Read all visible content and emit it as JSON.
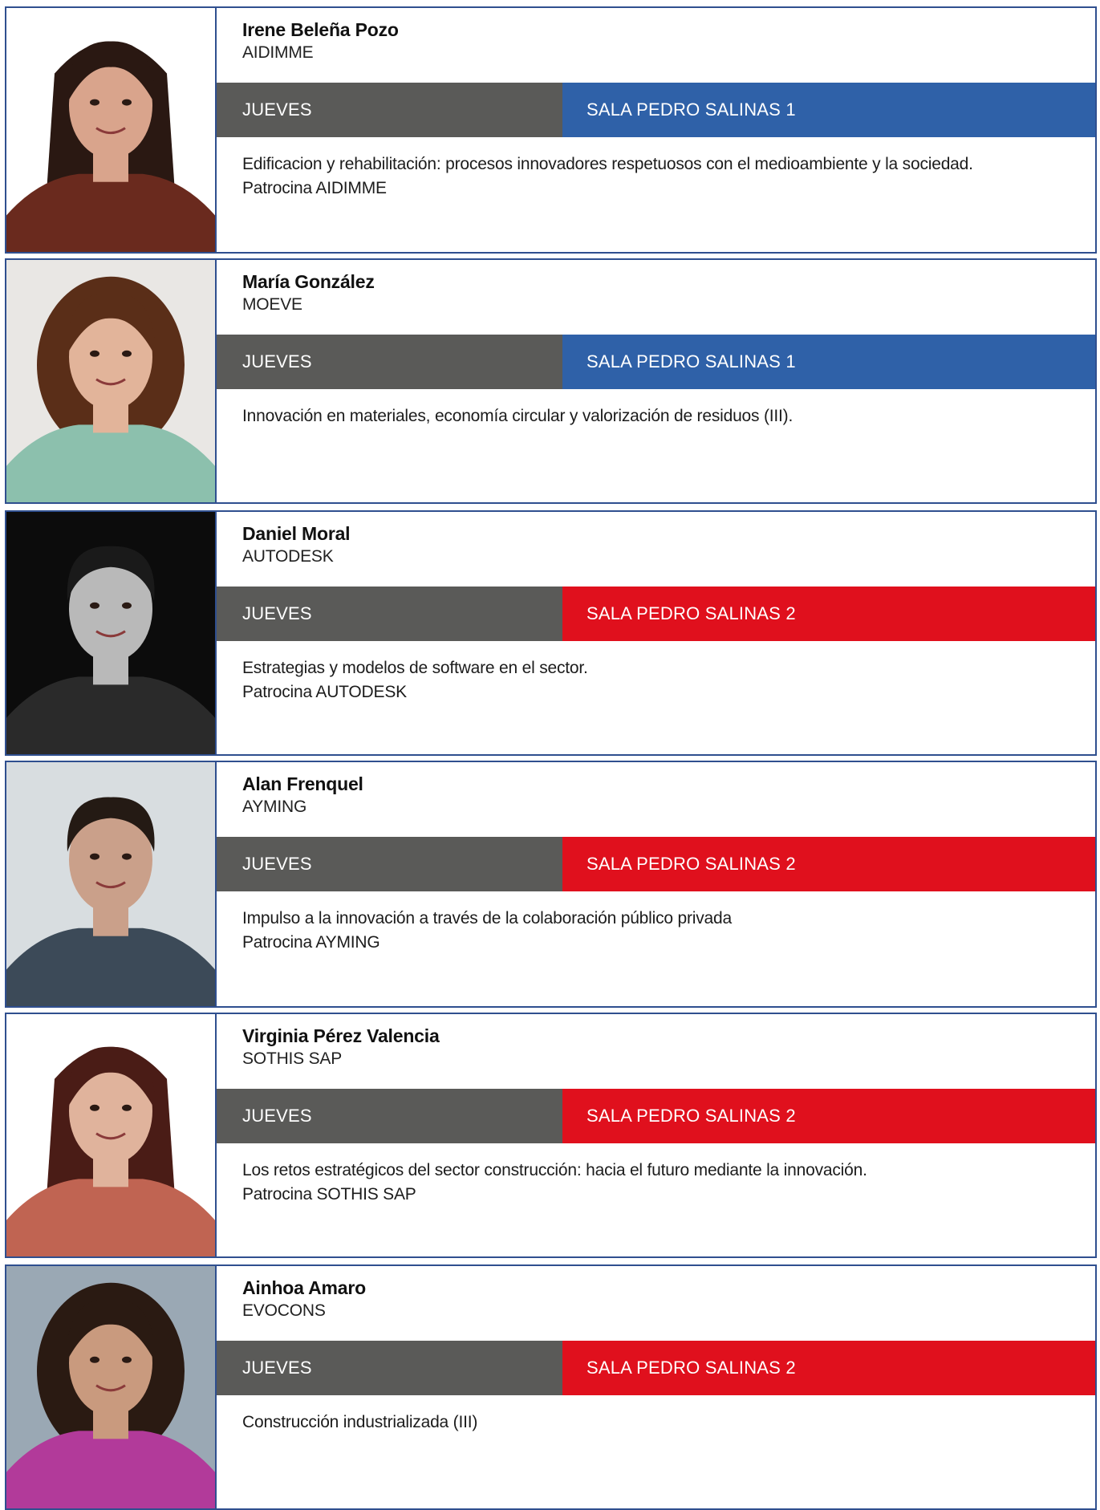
{
  "speakers": [
    {
      "name": "Irene Beleña Pozo",
      "company": "AIDIMME",
      "day": "JUEVES",
      "room": "SALA PEDRO SALINAS 1",
      "room_color": "#2f61a8",
      "description": "Edificacion y rehabilitación: procesos innovadores respetuosos con el medioambiente y la sociedad.",
      "sponsor": "Patrocina AIDIMME",
      "photo": {
        "background": "#ffffff",
        "hair": "#2a1812",
        "skin": "#d9a48c",
        "clothing": "#6a2a1e",
        "hair_style": "long"
      }
    },
    {
      "name": "María González",
      "company": "MOEVE",
      "day": "JUEVES",
      "room": "SALA PEDRO SALINAS 1",
      "room_color": "#2f61a8",
      "description": "Innovación en materiales, economía circular y valorización de residuos (III).",
      "sponsor": "",
      "photo": {
        "background": "#e9e7e4",
        "hair": "#5a2e18",
        "skin": "#e2b49a",
        "clothing": "#8cc0ad",
        "hair_style": "curly"
      }
    },
    {
      "name": "Daniel Moral",
      "company": "AUTODESK",
      "day": "JUEVES",
      "room": "SALA PEDRO SALINAS 2",
      "room_color": "#e0101d",
      "description": "Estrategias y modelos de software en el sector.",
      "sponsor": "Patrocina AUTODESK",
      "photo": {
        "background": "#0c0c0c",
        "hair": "#1a1a1a",
        "skin": "#b9b9b9",
        "clothing": "#2a2a2a",
        "hair_style": "short"
      }
    },
    {
      "name": "Alan Frenquel",
      "company": "AYMING",
      "day": "JUEVES",
      "room": "SALA PEDRO SALINAS 2",
      "room_color": "#e0101d",
      "description": "Impulso a la innovación a través de la colaboración público privada",
      "sponsor": "Patrocina AYMING",
      "photo": {
        "background": "#d8dde0",
        "hair": "#241a14",
        "skin": "#caa08a",
        "clothing": "#3c4a58",
        "hair_style": "short"
      }
    },
    {
      "name": "Virginia Pérez Valencia",
      "company": "SOTHIS SAP",
      "day": "JUEVES",
      "room": "SALA PEDRO SALINAS 2",
      "room_color": "#e0101d",
      "description": "Los retos estratégicos del sector construcción: hacia el futuro mediante la innovación.",
      "sponsor": "Patrocina SOTHIS SAP",
      "photo": {
        "background": "#ffffff",
        "hair": "#4a1c16",
        "skin": "#e0b39c",
        "clothing": "#c06452",
        "hair_style": "long"
      }
    },
    {
      "name": "Ainhoa Amaro",
      "company": "EVOCONS",
      "day": "JUEVES",
      "room": "SALA PEDRO SALINAS 2",
      "room_color": "#e0101d",
      "description": "Construcción industrializada (III)",
      "sponsor": "",
      "photo": {
        "background": "#9aa8b4",
        "hair": "#2a1a12",
        "skin": "#c99a7e",
        "clothing": "#b23a9a",
        "hair_style": "curly"
      }
    }
  ]
}
